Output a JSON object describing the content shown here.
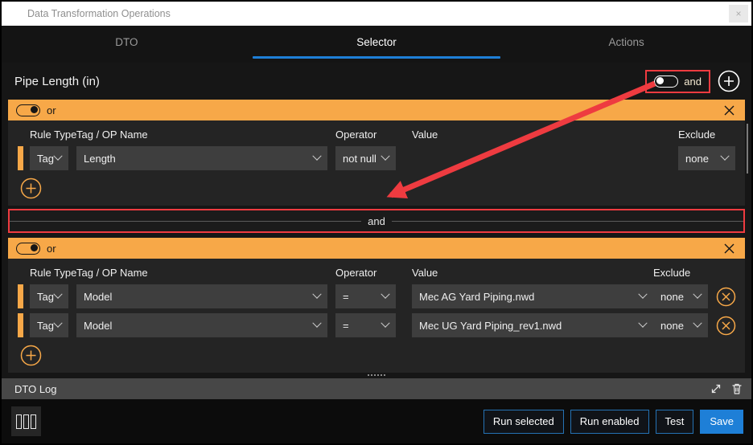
{
  "window": {
    "title": "Data Transformation Operations",
    "close": "×"
  },
  "tabs": {
    "dto": "DTO",
    "selector": "Selector",
    "actions": "Actions"
  },
  "selector": {
    "title": "Pipe Length (in)",
    "join_toggle": {
      "label": "and",
      "state": "off"
    },
    "divider": {
      "label": "and"
    },
    "headers": {
      "rule_type": "Rule Type",
      "tag_op": "Tag / OP Name",
      "operator": "Operator",
      "value": "Value",
      "exclude": "Exclude"
    },
    "group1": {
      "toggle_label": "or",
      "toggle_state": "on",
      "rule1": {
        "rule_type": "Tag",
        "tag_op": "Length",
        "operator": "not null",
        "exclude": "none"
      }
    },
    "group2": {
      "toggle_label": "or",
      "toggle_state": "on",
      "rule1": {
        "rule_type": "Tag",
        "tag_op": "Model",
        "operator": "=",
        "value": "Mec AG Yard Piping.nwd",
        "exclude": "none"
      },
      "rule2": {
        "rule_type": "Tag",
        "tag_op": "Model",
        "operator": "=",
        "value": "Mec UG Yard Piping_rev1.nwd",
        "exclude": "none"
      }
    }
  },
  "log": {
    "title": "DTO Log"
  },
  "footer": {
    "run_selected": "Run selected",
    "run_enabled": "Run enabled",
    "test": "Test",
    "save": "Save"
  },
  "colors": {
    "accent_orange": "#f7a848",
    "accent_blue": "#1e7fd7",
    "annotation_red": "#ee3b40"
  }
}
